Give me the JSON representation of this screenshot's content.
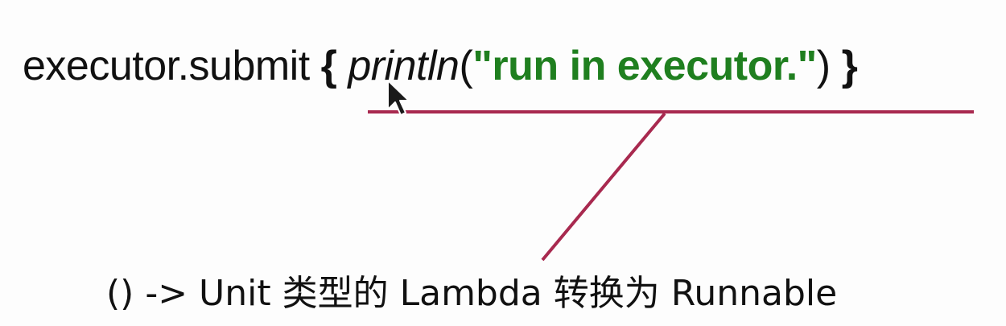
{
  "code": {
    "receiver": "executor.submit ",
    "open_brace": "{ ",
    "function_name": "println",
    "open_paren": "(",
    "string_literal": "\"run in executor.\"",
    "close_paren": ")",
    "close_brace": " }"
  },
  "caption": "() -> Unit 类型的 Lambda 转换为 Runnable",
  "colors": {
    "string": "#1f7f1f",
    "annotation_line": "#a8294f",
    "text": "#111111"
  },
  "icons": {
    "cursor": "mouse-pointer-icon"
  }
}
